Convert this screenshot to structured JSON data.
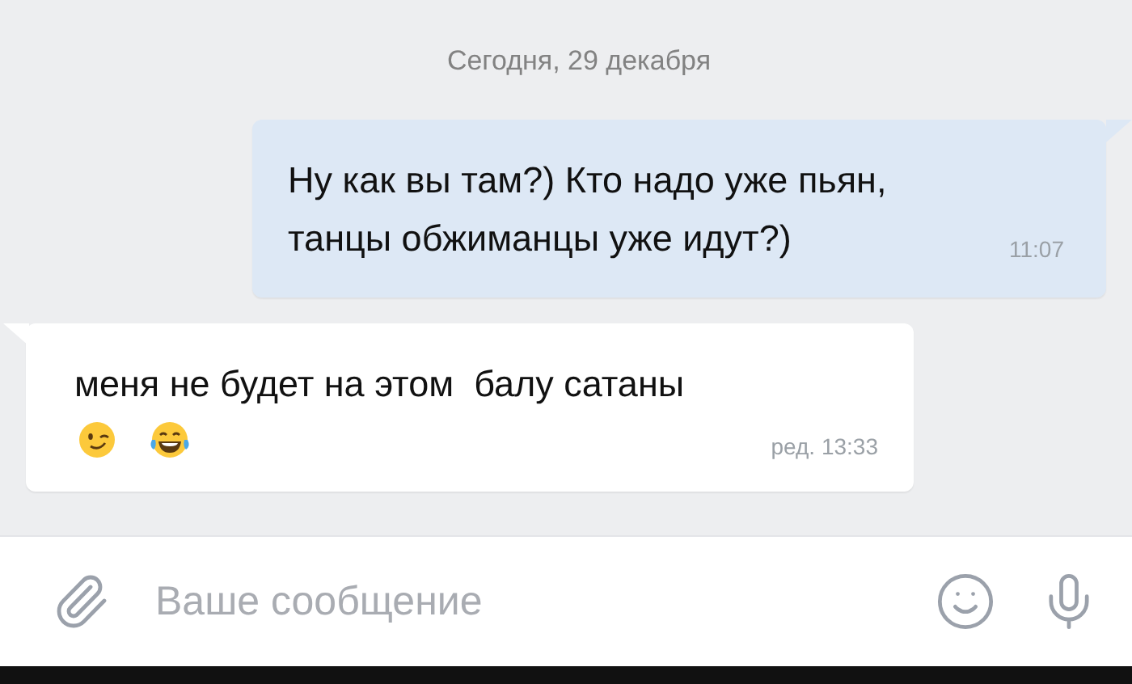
{
  "date_separator": "Сегодня, 29 декабря",
  "messages": [
    {
      "kind": "outgoing",
      "text": "Ну как вы там?) Кто надо уже пьян, танцы обжиманцы уже идут?)",
      "time": "11:07"
    },
    {
      "kind": "incoming",
      "text": "меня не будет на этом  балу сатаны",
      "emoji": [
        {
          "kind": "wink"
        },
        {
          "kind": "tears-of-joy"
        }
      ],
      "time": "ред. 13:33"
    }
  ],
  "composer": {
    "placeholder": "Ваше сообщение"
  }
}
